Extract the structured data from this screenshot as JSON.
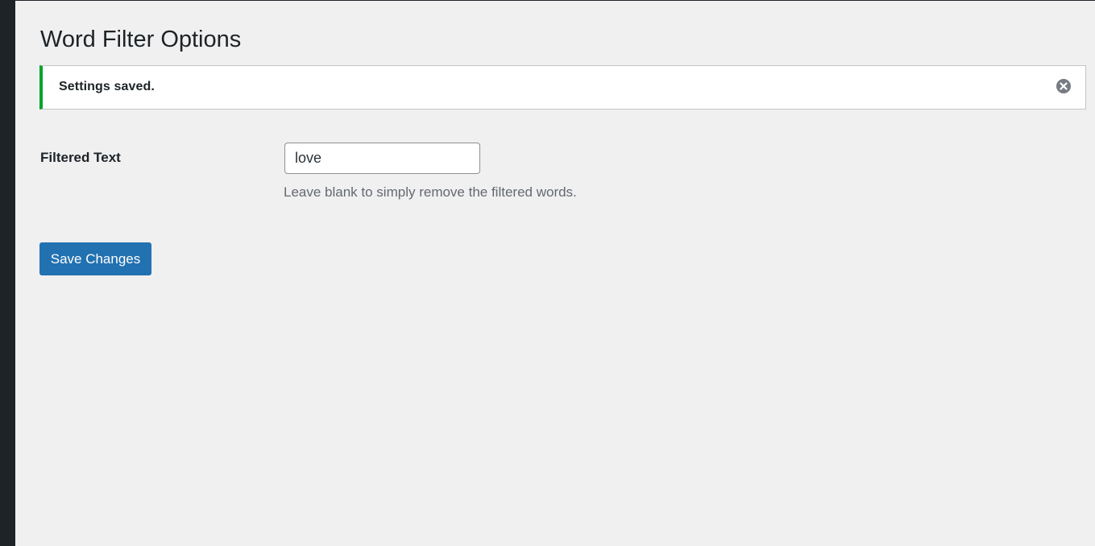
{
  "page": {
    "title": "Word Filter Options"
  },
  "notice": {
    "message": "Settings saved.",
    "status_color": "#00a32a",
    "dismiss_icon": "dismiss-circle-x-icon"
  },
  "form": {
    "filtered_text": {
      "label": "Filtered Text",
      "value": "love",
      "description": "Leave blank to simply remove the filtered words."
    },
    "save_label": "Save Changes"
  },
  "colors": {
    "background": "#f0f0f1",
    "sidebar": "#1d2327",
    "primary_button": "#2271b1"
  }
}
